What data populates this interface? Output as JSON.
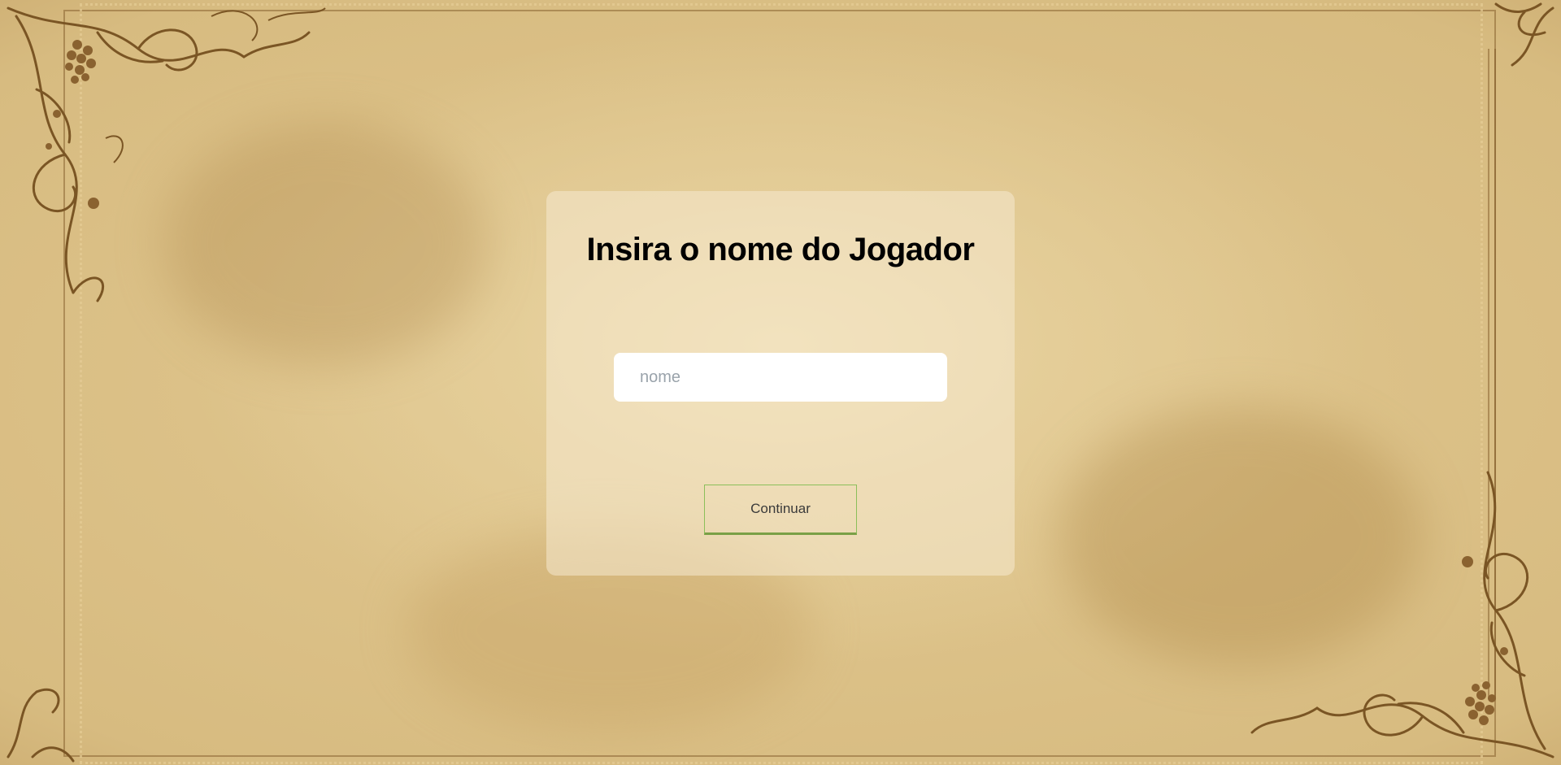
{
  "form": {
    "title": "Insira o nome do Jogador",
    "name_placeholder": "nome",
    "name_value": "",
    "continue_label": "Continuar"
  },
  "colors": {
    "button_border": "#8bbf5a",
    "button_underline": "#7aa046",
    "ornament": "#7a5524"
  }
}
